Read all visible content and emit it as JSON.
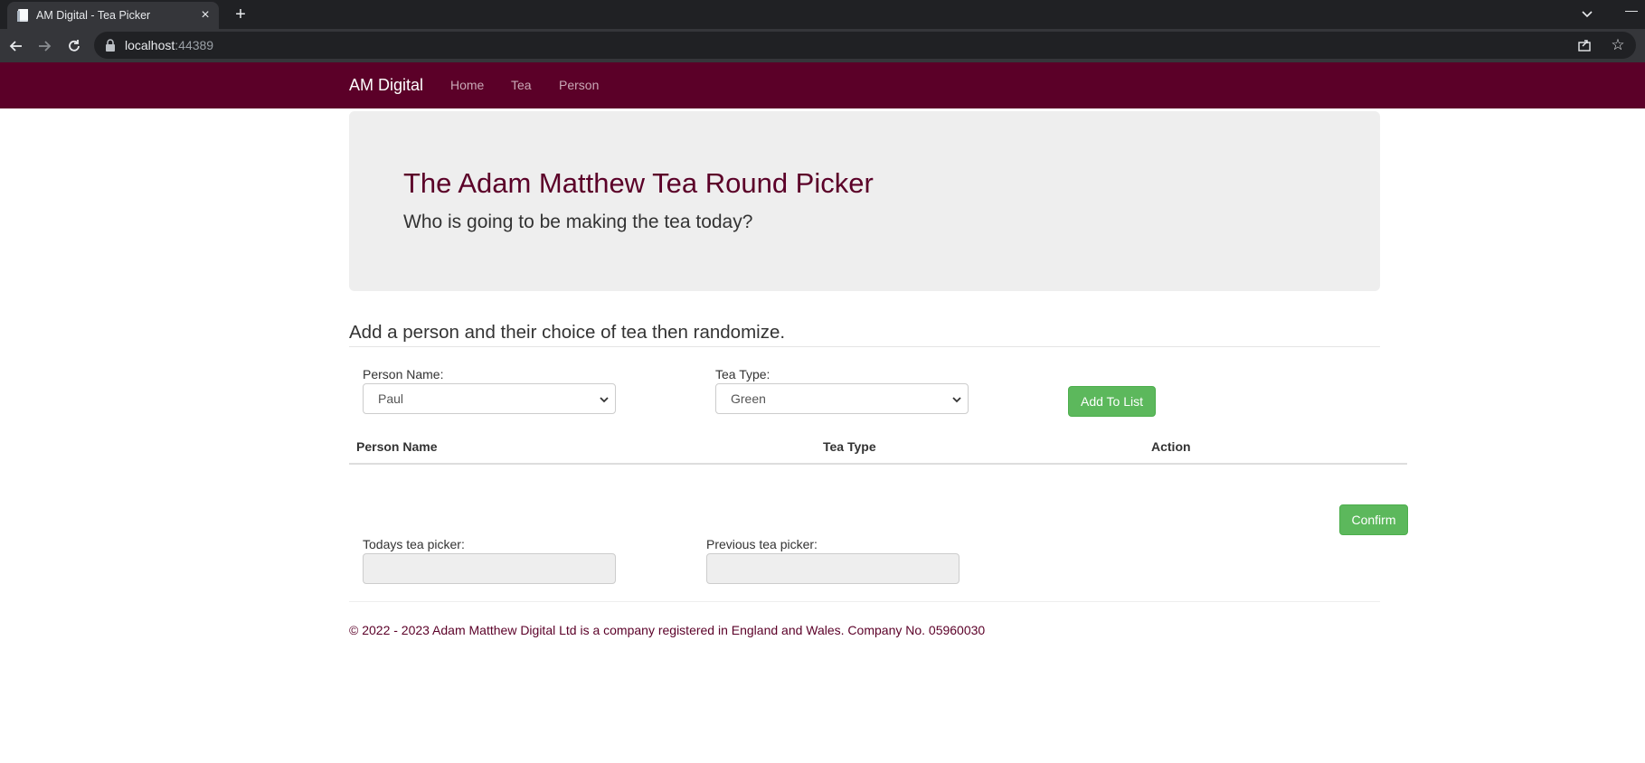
{
  "browser": {
    "tab_title": "AM Digital - Tea Picker",
    "url_host": "localhost",
    "url_port": ":44389"
  },
  "navbar": {
    "brand": "AM Digital",
    "links": [
      "Home",
      "Tea",
      "Person"
    ]
  },
  "jumbotron": {
    "title": "The Adam Matthew Tea Round Picker",
    "subtitle": "Who is going to be making the tea today?"
  },
  "form": {
    "heading": "Add a person and their choice of tea then randomize.",
    "person_label": "Person Name:",
    "person_value": "Paul",
    "tea_label": "Tea Type:",
    "tea_value": "Green",
    "add_button": "Add To List"
  },
  "table": {
    "headers": [
      "Person Name",
      "Tea Type",
      "Action"
    ],
    "rows": []
  },
  "results": {
    "confirm_button": "Confirm",
    "today_label": "Todays tea picker:",
    "today_value": "",
    "previous_label": "Previous tea picker:",
    "previous_value": ""
  },
  "footer": {
    "text": "© 2022 - 2023 Adam Matthew Digital Ltd is a company registered in England and Wales. Company No. 05960030"
  },
  "colors": {
    "brand": "#5b0028",
    "success": "#5cb85c",
    "jumbotron_bg": "#eeeeee"
  },
  "icons": [
    "document-favicon-icon",
    "close-icon",
    "plus-icon",
    "back-arrow-icon",
    "forward-arrow-icon",
    "reload-icon",
    "lock-icon",
    "share-icon",
    "star-icon",
    "tab-search-icon",
    "minimize-icon",
    "chevron-down-icon"
  ]
}
